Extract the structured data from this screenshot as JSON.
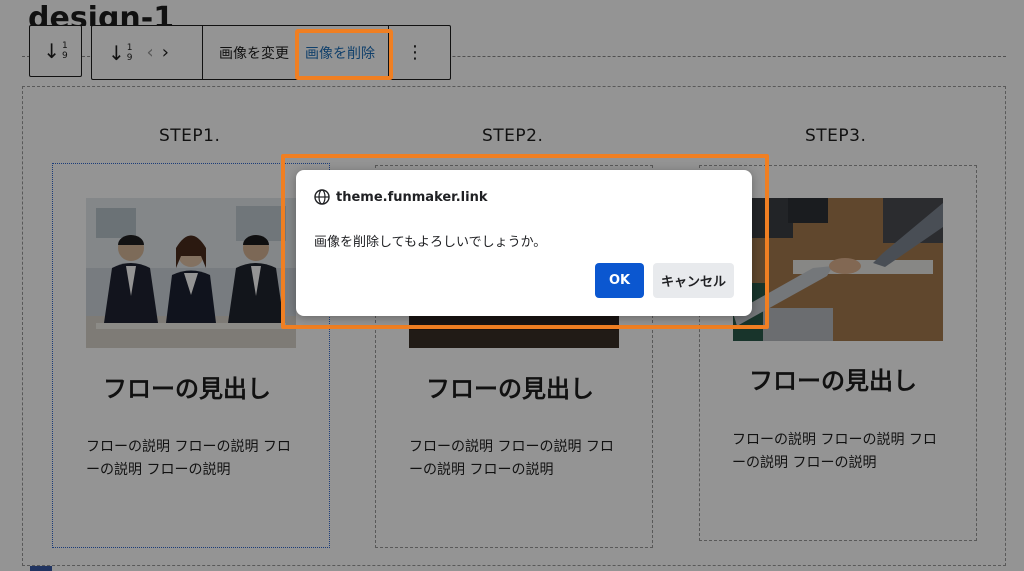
{
  "page": {
    "title": "design-1"
  },
  "toolbar": {
    "sort_digit_top": "1",
    "sort_digit_bottom": "9",
    "replace_image": "画像を変更",
    "delete_image": "画像を削除",
    "more": "⋮"
  },
  "steps": [
    {
      "label": "STEP1.",
      "title": "フローの見出し",
      "desc": "フローの説明 フローの説明 フローの説明 フローの説明",
      "image": "business-people-photo"
    },
    {
      "label": "STEP2.",
      "title": "フローの見出し",
      "desc": "フローの説明 フローの説明 フローの説明 フローの説明",
      "image": "dark-photo"
    },
    {
      "label": "STEP3.",
      "title": "フローの見出し",
      "desc": "フローの説明 フローの説明 フローの説明 フローの説明",
      "image": "handshake-photo"
    }
  ],
  "dialog": {
    "origin": "theme.funmaker.link",
    "message": "画像を削除してもよろしいでしょうか。",
    "ok_label": "OK",
    "cancel_label": "キャンセル"
  },
  "colors": {
    "highlight": "#f07f22",
    "ok_button": "#0b57d0",
    "link_blue": "#1e6fb8"
  }
}
